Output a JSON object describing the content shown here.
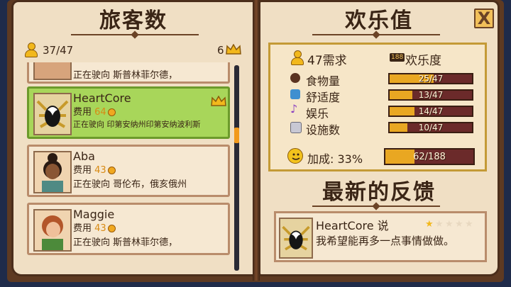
{
  "left_page": {
    "title": "旅客数",
    "guest_count": "37/47",
    "crown_count": "6",
    "partial_card_text": "正在驶向 斯普林菲尔德，",
    "travelers": [
      {
        "name": "HeartCore",
        "fee_label": "费用",
        "fee": "64",
        "destination": "正在驶向 印第安纳州印第安纳波利斯",
        "selected": true,
        "has_crown": true
      },
      {
        "name": "Aba",
        "fee_label": "费用",
        "fee": "43",
        "destination": "正在驶向 哥伦布，俄亥俄州",
        "selected": false,
        "has_crown": false
      },
      {
        "name": "Maggie",
        "fee_label": "费用",
        "fee": "43",
        "destination": "正在驶向 斯普林菲尔德，",
        "selected": false,
        "has_crown": false
      }
    ]
  },
  "right_page": {
    "title": "欢乐值",
    "close_label": "X",
    "needs_label": "47需求",
    "joy_badge": "188",
    "joy_label": "欢乐度",
    "stats": [
      {
        "label": "食物量",
        "value": "25/47",
        "fraction": 0.532,
        "icon": "food-icon",
        "color": "#7a4a2a"
      },
      {
        "label": "舒适度",
        "value": "13/47",
        "fraction": 0.277,
        "icon": "comfort-icon",
        "color": "#3f8fd0"
      },
      {
        "label": "娱乐",
        "value": "14/47",
        "fraction": 0.298,
        "icon": "music-note-icon",
        "color": "#8a3fc0"
      },
      {
        "label": "设施数",
        "value": "10/47",
        "fraction": 0.213,
        "icon": "toilet-icon",
        "color": "#9a9aa8"
      }
    ],
    "bonus_label": "加成: 33%",
    "bonus_value": "62/188",
    "bonus_fraction": 0.33,
    "feedback_title": "最新的反馈",
    "feedback": {
      "speaker": "HeartCore 说",
      "rating_stars": 1,
      "max_stars": 5,
      "message": "我希望能再多一点事情做做。"
    }
  },
  "colors": {
    "accent_gold": "#f2b81c",
    "selected_card": "#a8d65a",
    "bar_fill": "#e9a722",
    "bar_empty": "#6b2a2a"
  }
}
